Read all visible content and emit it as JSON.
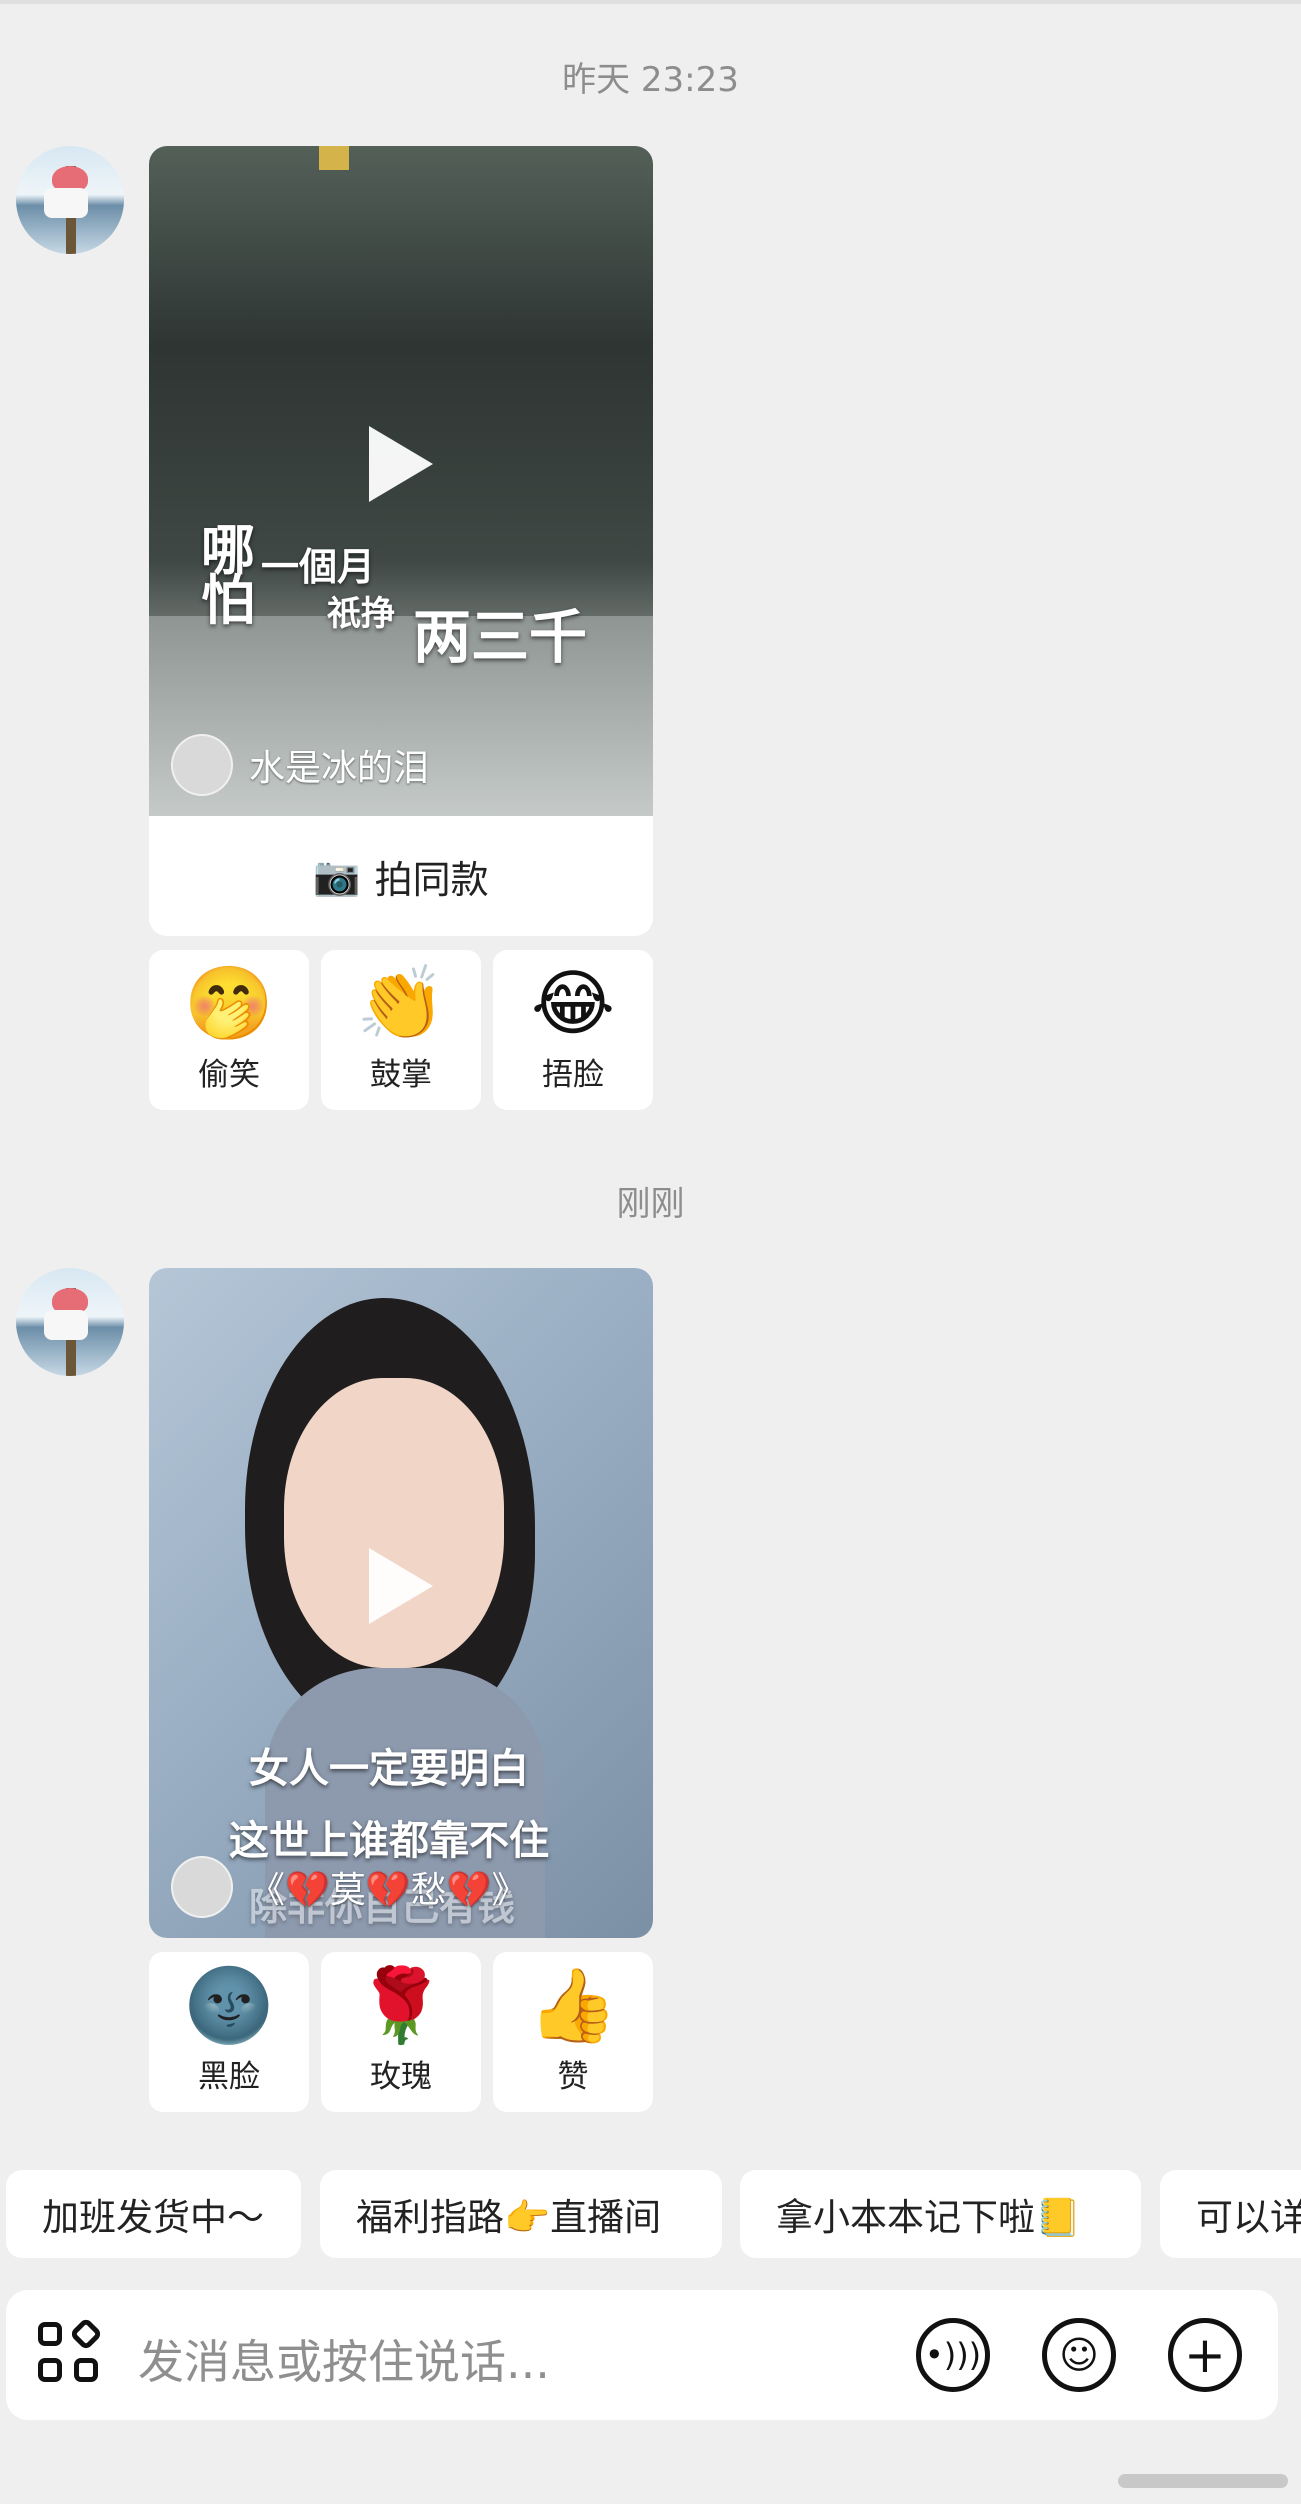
{
  "time1": "昨天 23:23",
  "time2": "刚刚",
  "video1": {
    "author": "水是冰的泪",
    "overlay": [
      "哪",
      "怕",
      "一個月",
      "祇挣",
      "两三千"
    ],
    "action": "拍同款"
  },
  "reactions1": [
    {
      "emoji": "🤭",
      "label": "偷笑"
    },
    {
      "emoji": "👏",
      "label": "鼓掌"
    },
    {
      "emoji": "😂",
      "label": "捂脸"
    }
  ],
  "video2": {
    "author": "《💔莫💔愁💔》",
    "overlay": [
      "女人一定要明白",
      "这世上谁都靠不住",
      "除非你自己有钱"
    ]
  },
  "reactions2": [
    {
      "emoji": "🌚",
      "label": "黑脸"
    },
    {
      "emoji": "🌹",
      "label": "玫瑰"
    },
    {
      "emoji": "👍",
      "label": "赞"
    }
  ],
  "chips": [
    "加班发货中～",
    "福利指路👉直播间",
    "拿小本本记下啦📒",
    "可以详"
  ],
  "composer": {
    "placeholder": "发消息或按住说话..."
  }
}
